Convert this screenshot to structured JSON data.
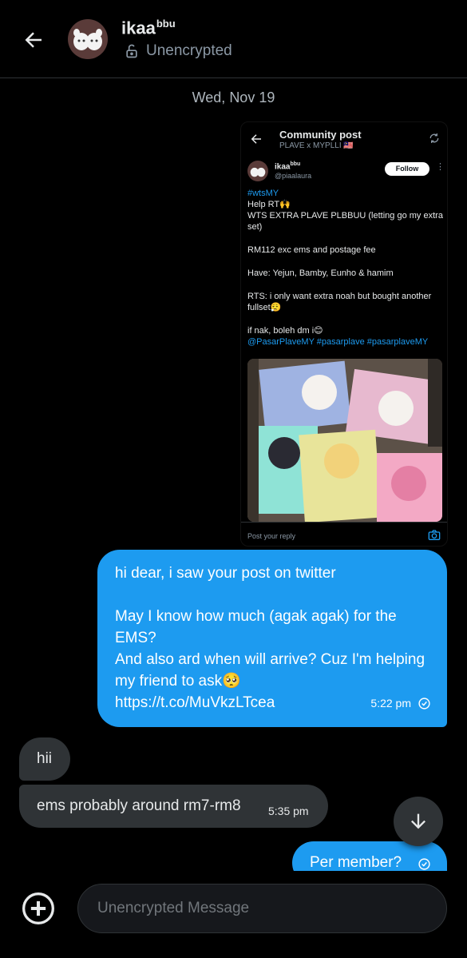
{
  "header": {
    "contact_name": "ikaa",
    "contact_name_sup": "bbu",
    "encryption_status": "Unencrypted"
  },
  "date_separator": "Wed, Nov 19",
  "shared_post": {
    "title": "Community post",
    "subtitle": "PLAVE x MYPLLI 🇲🇾",
    "user_name": "ikaa",
    "user_name_sup": "bbu",
    "user_handle": "@piaalaura",
    "follow_label": "Follow",
    "hashtag": "#wtsMY",
    "line1": "Help RT🙌",
    "line2": "WTS EXTRA PLAVE PLBBUU (letting go my extra set)",
    "line3": "RM112 exc ems and postage fee",
    "line4": "Have: Yejun, Bamby, Eunho & hamim",
    "line5": "RTS: i only want extra noah but bought another fullset😮‍💨",
    "line6": "if nak, boleh dm i😊",
    "mentions": "@PasarPlaveMY #pasarplave #pasarplaveMY",
    "reply_placeholder": "Post your reply"
  },
  "messages": {
    "m1": {
      "line1": "hi dear, i saw your post on twitter",
      "line2": "May I know how much (agak agak) for the EMS?",
      "line3": "And also ard when will arrive? Cuz I'm helping my friend to ask🥺",
      "line4": "https://t.co/MuVkzLTcea",
      "time": "5:22 pm"
    },
    "m2": {
      "text": "hii"
    },
    "m3": {
      "text": "ems probably around rm7-rm8",
      "time": "5:35 pm"
    },
    "m4": {
      "text": "Per member?"
    }
  },
  "composer": {
    "placeholder": "Unencrypted Message"
  },
  "icons": {
    "back": "arrow-left-icon",
    "lock": "lock-open-icon",
    "scroll_down": "arrow-down-icon",
    "add": "plus-circle-icon",
    "read": "check-circle-icon"
  },
  "colors": {
    "accent": "#1d9bf0",
    "incoming_bubble": "#2f3336",
    "background": "#000000"
  }
}
